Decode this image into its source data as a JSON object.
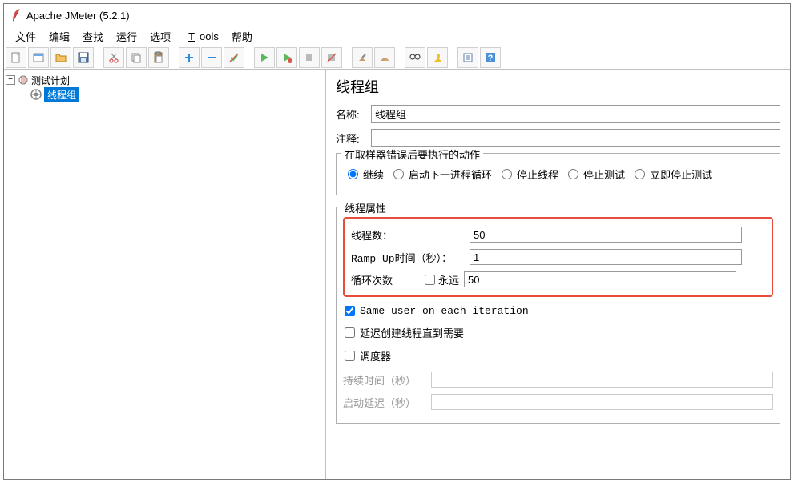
{
  "window": {
    "title": "Apache JMeter (5.2.1)"
  },
  "menu": {
    "file": "文件",
    "edit": "编辑",
    "search": "查找",
    "run": "运行",
    "options": "选项",
    "tools": "Tools",
    "help": "帮助"
  },
  "tree": {
    "root_toggle": "−",
    "root": "测试计划",
    "child": "线程组"
  },
  "panel": {
    "title": "线程组",
    "name_label": "名称:",
    "name_value": "线程组",
    "comment_label": "注释:",
    "comment_value": ""
  },
  "error_action": {
    "legend": "在取样器错误后要执行的动作",
    "continue": "继续",
    "next_loop": "启动下一进程循环",
    "stop_thread": "停止线程",
    "stop_test": "停止测试",
    "stop_now": "立即停止测试"
  },
  "thread_props": {
    "legend": "线程属性",
    "threads_label": "线程数：",
    "threads_value": "50",
    "rampup_label": "Ramp-Up时间（秒）：",
    "rampup_value": "1",
    "loops_label": "循环次数",
    "forever_label": "永远",
    "loops_value": "50",
    "same_user": "Same user on each iteration",
    "delay_create": "延迟创建线程直到需要",
    "scheduler": "调度器",
    "duration": "持续时间（秒）",
    "startup_delay": "启动延迟（秒）"
  }
}
